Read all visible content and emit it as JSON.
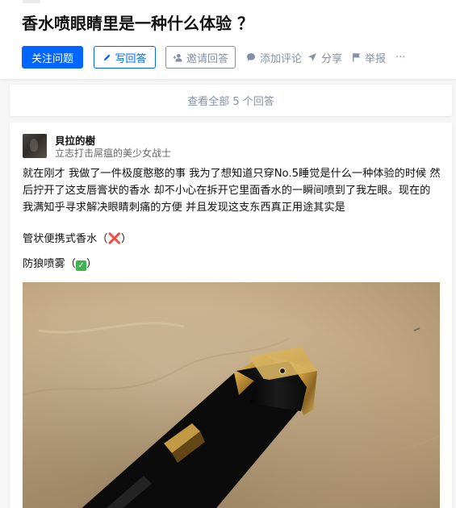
{
  "question": {
    "title": "香水喷眼睛里是一种什么体验 ？"
  },
  "actions": {
    "follow_label": "关注问题",
    "write_label": "写回答",
    "invite_label": "邀请回答",
    "comment_label": "添加评论",
    "share_label": "分享",
    "report_label": "举报",
    "more_label": "···"
  },
  "view_all": {
    "label": "查看全部 5 个回答"
  },
  "answer": {
    "author_name": "貝拉的樹",
    "author_bio": "立志打击屌瘟的美少女战士",
    "paragraph_1": "就在刚才 我做了一件极度憨憨的事 我为了想知道只穿No.5睡觉是什么一种体验的时候 然后拧开了这支唇膏状的香水 却不小心在拆开它里面香水的一瞬间喷到了我左眼。现在的我满知乎寻求解决眼睛刺痛的方便 并且发现这支东西真正用途其实是",
    "line_2_text": "管状便携式香水（",
    "line_2_mark": "❌",
    "line_2_end": "）",
    "line_3_text": "防狼喷雾（",
    "line_3_mark": "✓",
    "line_3_end": "）"
  },
  "colors": {
    "brand_blue": "#0066ff",
    "muted_gray": "#8590a6",
    "page_bg": "#f6f6f6"
  },
  "icons": {
    "write": "pencil-icon",
    "invite": "add-user-icon",
    "comment": "comment-bubble-icon",
    "share": "paper-plane-icon",
    "report": "flag-icon"
  }
}
